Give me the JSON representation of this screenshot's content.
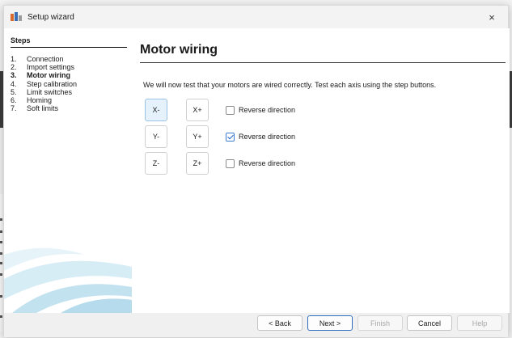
{
  "window": {
    "title": "Setup wizard",
    "close_label": "×"
  },
  "steps": {
    "heading": "Steps",
    "items": [
      {
        "num": "1.",
        "label": "Connection"
      },
      {
        "num": "2.",
        "label": "Import settings"
      },
      {
        "num": "3.",
        "label": "Motor wiring"
      },
      {
        "num": "4.",
        "label": "Step calibration"
      },
      {
        "num": "5.",
        "label": "Limit switches"
      },
      {
        "num": "6.",
        "label": "Homing"
      },
      {
        "num": "7.",
        "label": "Soft limits"
      }
    ],
    "active_index": 2
  },
  "page": {
    "title": "Motor wiring",
    "instructions": "We will now test that your motors are wired correctly. Test each axis using the step buttons."
  },
  "axes": [
    {
      "minus": "X-",
      "plus": "X+",
      "reverse_label": "Reverse direction",
      "reverse_checked": false
    },
    {
      "minus": "Y-",
      "plus": "Y+",
      "reverse_label": "Reverse direction",
      "reverse_checked": true
    },
    {
      "minus": "Z-",
      "plus": "Z+",
      "reverse_label": "Reverse direction",
      "reverse_checked": false
    }
  ],
  "footer": {
    "back_label": "< Back",
    "next_label": "Next >",
    "finish_label": "Finish",
    "cancel_label": "Cancel",
    "help_label": "Help"
  },
  "colors": {
    "accent": "#1e66c8",
    "swoosh": "#c9e6f2"
  }
}
